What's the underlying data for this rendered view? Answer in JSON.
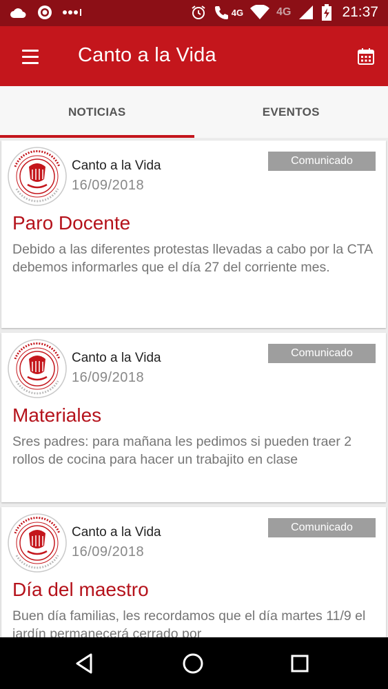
{
  "status_bar": {
    "icons_left": [
      "cloud-icon",
      "target-icon",
      "more-dots-icon"
    ],
    "network_label": "4G",
    "network_label_2": "4G",
    "time": "21:37"
  },
  "app_bar": {
    "title": "Canto a la Vida",
    "menu_icon": "menu-icon",
    "calendar_icon": "calendar-icon"
  },
  "tabs": [
    {
      "label": "NOTICIAS",
      "active": true
    },
    {
      "label": "EVENTOS",
      "active": false
    }
  ],
  "posts": [
    {
      "author": "Canto a la Vida",
      "date": "16/09/2018",
      "badge": "Comunicado",
      "title": "Paro Docente",
      "body": "Debido a las diferentes protestas llevadas a cabo por la CTA debemos informarles que el día 27 del corriente mes."
    },
    {
      "author": "Canto a la Vida",
      "date": "16/09/2018",
      "badge": "Comunicado",
      "title": "Materiales",
      "body": "Sres padres: para mañana les pedimos si pueden traer 2 rollos de cocina para hacer un trabajito en clase"
    },
    {
      "author": "Canto a la Vida",
      "date": "16/09/2018",
      "badge": "Comunicado",
      "title": "Día del maestro",
      "body": "Buen día familias, les recordamos que el día martes 11/9 el jardín permanecerá cerrado por"
    }
  ],
  "colors": {
    "status_bar": "#8c0f16",
    "app_bar": "#c4161c",
    "accent": "#b5121b",
    "badge": "#9e9e9e"
  },
  "nav_bar": {
    "icons": [
      "back-icon",
      "home-icon",
      "recents-icon"
    ]
  }
}
